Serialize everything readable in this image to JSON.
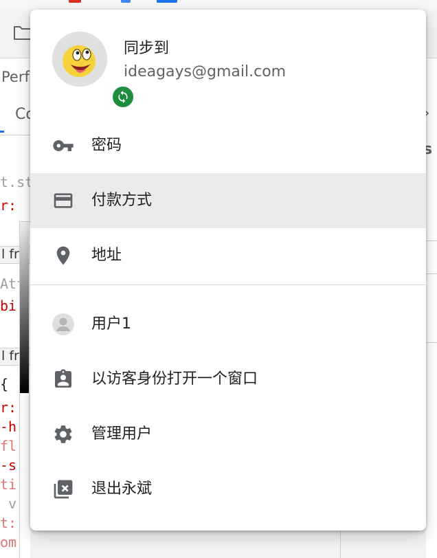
{
  "background": {
    "perf_label": "Perf",
    "console_label": "Co",
    "code_lines": [
      {
        "text": "t.st",
        "color": "gray"
      },
      {
        "text": "r:",
        "color": "red"
      },
      {
        "text": "Att",
        "color": "gray"
      },
      {
        "text": "bi",
        "color": "red"
      },
      {
        "text": "{",
        "color": "black"
      },
      {
        "text": "r:",
        "color": "red"
      },
      {
        "text": "-h",
        "color": "red"
      },
      {
        "text": "fl",
        "color": "red"
      },
      {
        "text": "-s",
        "color": "red"
      },
      {
        "text": "ti",
        "color": "red"
      },
      {
        "text": "v",
        "color": "gray"
      },
      {
        "text": "t:",
        "color": "red"
      },
      {
        "text": "om",
        "color": "red"
      }
    ],
    "sidebar_labels": [
      "l fr",
      "l fr"
    ],
    "right_fragment": "s",
    "right_chevron": "›"
  },
  "profile_menu": {
    "sync_title": "同步到",
    "email": "ideagays@gmail.com",
    "avatar_icon": "emoji-face-avatar",
    "badge_icon": "sync-icon",
    "badge_color": "#1e8e3e",
    "autofill_items": [
      {
        "label": "密码",
        "icon": "key-icon"
      },
      {
        "label": "付款方式",
        "icon": "credit-card-icon"
      },
      {
        "label": "地址",
        "icon": "location-pin-icon"
      }
    ],
    "people_items": [
      {
        "label": "用户1",
        "icon": "person-avatar-icon"
      },
      {
        "label": "以访客身份打开一个窗口",
        "icon": "guest-badge-icon"
      },
      {
        "label": "管理用户",
        "icon": "gear-icon"
      },
      {
        "label": "退出永斌",
        "icon": "close-window-icon"
      }
    ],
    "selected_item": "付款方式",
    "selected_bg_color": "#ebebeb"
  }
}
